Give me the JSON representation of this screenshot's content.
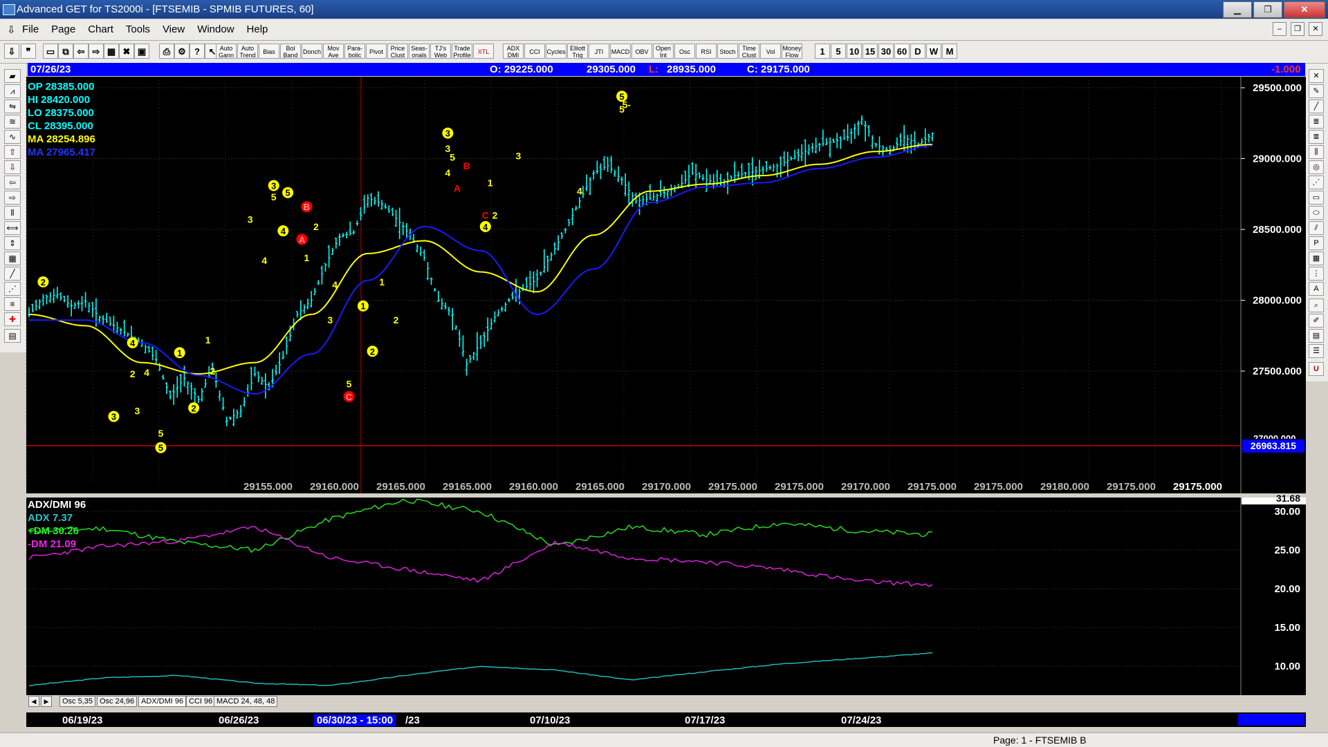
{
  "window": {
    "title": "Advanced GET for TS2000i - [FTSEMIB - SPMIB FUTURES, 60]"
  },
  "menu": {
    "items": [
      "File",
      "Page",
      "Chart",
      "Tools",
      "View",
      "Window",
      "Help"
    ]
  },
  "toolbar": {
    "buttons": [
      "Auto Gann",
      "Auto Trend",
      "Bias",
      "Bol Band",
      "Donch",
      "Mov Ave",
      "Para-bolic",
      "Pivot",
      "Price Clust",
      "Seas-onals",
      "TJ's Web",
      "Trade Profile",
      "XTL",
      "ADX DMI",
      "CCI",
      "Cycles",
      "Elliott Trig",
      "JTI",
      "MACD",
      "OBV",
      "Open Int",
      "Osc",
      "RSI",
      "Stoch",
      "Time Clust",
      "Vol",
      "Money Flow"
    ],
    "timeframes": [
      "1",
      "5",
      "10",
      "15",
      "30",
      "60",
      "D",
      "W",
      "M"
    ]
  },
  "info_bar": {
    "date": "07/26/23",
    "open": "O: 29225.000",
    "high": "29305.000",
    "low_label": "L:",
    "low": "28935.000",
    "close": "C: 29175.000",
    "change": "-1.000"
  },
  "readout": {
    "op": "OP 28385.000",
    "hi": "HI  28420.000",
    "lo": "LO  28375.000",
    "cl": "CL  28395.000",
    "ma1": "MA  28254.896",
    "ma2": "MA  27965.417"
  },
  "price_axis": {
    "ticks": [
      "29500.000",
      "29000.000",
      "28500.000",
      "28000.000",
      "27500.000"
    ],
    "current": "26963.815",
    "cut_label": "27000.000"
  },
  "x_price_labels": [
    "29155.000",
    "29160.000",
    "29165.000",
    "29165.000",
    "29160.000",
    "29165.000",
    "29170.000",
    "29175.000",
    "29175.000",
    "29170.000",
    "29175.000",
    "29175.000",
    "29180.000",
    "29175.000",
    "29175.000"
  ],
  "colors": {
    "bars": "#00ffff",
    "ma_fast": "#ffff00",
    "ma_slow": "#1a1aff",
    "wave_yellow": "#ffff00",
    "wave_red": "#ff0000",
    "info_bar": "#0000ff"
  },
  "chart_data": [
    {
      "type": "line",
      "series": [
        {
          "name": "Price (close)",
          "x": [
            0,
            3,
            6,
            9,
            12,
            15,
            18,
            21,
            24,
            27,
            30,
            33,
            36,
            39,
            42,
            45,
            48,
            51,
            54,
            57,
            60,
            63,
            66,
            69,
            72,
            75,
            78,
            81,
            84,
            87,
            90,
            93,
            96,
            99,
            102,
            105,
            108,
            111,
            114,
            117,
            120,
            123,
            126,
            129,
            132,
            135,
            138,
            141,
            144,
            147,
            150,
            153,
            156,
            159,
            162,
            165,
            168,
            171,
            174,
            177,
            180,
            183,
            186,
            189,
            192
          ],
          "values": [
            27900,
            28020,
            28040,
            27960,
            27990,
            27880,
            27820,
            27760,
            27700,
            27580,
            27320,
            27450,
            27300,
            27520,
            27150,
            27220,
            27480,
            27380,
            27600,
            27900,
            28000,
            28250,
            28450,
            28480,
            28720,
            28680,
            28580,
            28460,
            28300,
            28000,
            27900,
            27550,
            27700,
            27880,
            28000,
            28080,
            28150,
            28320,
            28500,
            28700,
            28900,
            28950,
            28850,
            28700,
            28720,
            28760,
            28800,
            28900,
            28850,
            28820,
            28880,
            28900,
            28920,
            28950,
            29000,
            29050,
            29100,
            29120,
            29150,
            29280,
            29100,
            29050,
            29150,
            29100,
            29175
          ]
        },
        {
          "name": "MA 28254.896",
          "x": [
            0,
            12,
            24,
            36,
            48,
            60,
            72,
            84,
            96,
            108,
            120,
            132,
            144,
            156,
            168,
            180,
            192
          ],
          "values": [
            27900,
            27820,
            27560,
            27480,
            27560,
            27900,
            28330,
            28420,
            28200,
            28060,
            28460,
            28770,
            28820,
            28880,
            28960,
            29050,
            29100
          ]
        },
        {
          "name": "MA 27965.417",
          "x": [
            0,
            12,
            24,
            36,
            48,
            60,
            72,
            84,
            96,
            108,
            120,
            132,
            144,
            156,
            168,
            180,
            192
          ],
          "values": [
            27860,
            27860,
            27700,
            27470,
            27340,
            27620,
            28140,
            28520,
            28350,
            27900,
            28220,
            28690,
            28800,
            28830,
            28930,
            29010,
            29090
          ]
        }
      ],
      "ylim": [
        27000,
        29550
      ],
      "yticks": [
        27500,
        28000,
        28500,
        29000,
        29500
      ],
      "waves": [
        {
          "label": "2",
          "x": 3,
          "y": 28130,
          "circled": true,
          "color": "yellow"
        },
        {
          "label": "4",
          "x": 22,
          "y": 27700,
          "circled": true,
          "color": "yellow"
        },
        {
          "label": "2",
          "x": 22,
          "y": 27480,
          "circled": false,
          "color": "yellow"
        },
        {
          "label": "4",
          "x": 25,
          "y": 27490,
          "circled": false,
          "color": "yellow"
        },
        {
          "label": "3",
          "x": 18,
          "y": 27180,
          "circled": true,
          "color": "yellow"
        },
        {
          "label": "3",
          "x": 23,
          "y": 27220,
          "circled": false,
          "color": "yellow"
        },
        {
          "label": "5",
          "x": 28,
          "y": 27060,
          "circled": false,
          "color": "yellow"
        },
        {
          "label": "5",
          "x": 28,
          "y": 26960,
          "circled": true,
          "color": "yellow"
        },
        {
          "label": "1",
          "x": 32,
          "y": 27630,
          "circled": true,
          "color": "yellow"
        },
        {
          "label": "2",
          "x": 35,
          "y": 27240,
          "circled": true,
          "color": "yellow"
        },
        {
          "label": "1",
          "x": 38,
          "y": 27720,
          "circled": false,
          "color": "yellow"
        },
        {
          "label": "2",
          "x": 39,
          "y": 27500,
          "circled": false,
          "color": "yellow"
        },
        {
          "label": "3",
          "x": 47,
          "y": 28570,
          "circled": false,
          "color": "yellow"
        },
        {
          "label": "4",
          "x": 50,
          "y": 28280,
          "circled": false,
          "color": "yellow"
        },
        {
          "label": "3",
          "x": 52,
          "y": 28810,
          "circled": true,
          "color": "yellow"
        },
        {
          "label": "5",
          "x": 52,
          "y": 28730,
          "circled": false,
          "color": "yellow"
        },
        {
          "label": "5",
          "x": 55,
          "y": 28760,
          "circled": true,
          "color": "yellow"
        },
        {
          "label": "4",
          "x": 54,
          "y": 28490,
          "circled": true,
          "color": "yellow"
        },
        {
          "label": "B",
          "x": 59,
          "y": 28660,
          "circled": true,
          "color": "red"
        },
        {
          "label": "A",
          "x": 58,
          "y": 28430,
          "circled": true,
          "color": "red"
        },
        {
          "label": "2",
          "x": 61,
          "y": 28520,
          "circled": false,
          "color": "yellow"
        },
        {
          "label": "1",
          "x": 59,
          "y": 28300,
          "circled": false,
          "color": "yellow"
        },
        {
          "label": "4",
          "x": 65,
          "y": 28110,
          "circled": false,
          "color": "yellow"
        },
        {
          "label": "3",
          "x": 64,
          "y": 27860,
          "circled": false,
          "color": "yellow"
        },
        {
          "label": "5",
          "x": 68,
          "y": 27410,
          "circled": false,
          "color": "yellow"
        },
        {
          "label": "C",
          "x": 68,
          "y": 27320,
          "circled": true,
          "color": "red"
        },
        {
          "label": "1",
          "x": 71,
          "y": 27960,
          "circled": true,
          "color": "yellow"
        },
        {
          "label": "2",
          "x": 73,
          "y": 27640,
          "circled": true,
          "color": "yellow"
        },
        {
          "label": "1",
          "x": 75,
          "y": 28130,
          "circled": false,
          "color": "yellow"
        },
        {
          "label": "2",
          "x": 78,
          "y": 27860,
          "circled": false,
          "color": "yellow"
        },
        {
          "label": "3",
          "x": 89,
          "y": 29180,
          "circled": true,
          "color": "yellow"
        },
        {
          "label": "3",
          "x": 89,
          "y": 29070,
          "circled": false,
          "color": "yellow"
        },
        {
          "label": "5",
          "x": 90,
          "y": 29010,
          "circled": false,
          "color": "yellow"
        },
        {
          "label": "4",
          "x": 89,
          "y": 28900,
          "circled": false,
          "color": "yellow"
        },
        {
          "label": "B",
          "x": 93,
          "y": 28950,
          "circled": false,
          "color": "red"
        },
        {
          "label": "A",
          "x": 91,
          "y": 28790,
          "circled": false,
          "color": "red"
        },
        {
          "label": "1",
          "x": 98,
          "y": 28830,
          "circled": false,
          "color": "yellow"
        },
        {
          "label": "C",
          "x": 97,
          "y": 28600,
          "circled": false,
          "color": "red"
        },
        {
          "label": "2",
          "x": 99,
          "y": 28600,
          "circled": false,
          "color": "yellow"
        },
        {
          "label": "4",
          "x": 97,
          "y": 28520,
          "circled": true,
          "color": "yellow"
        },
        {
          "label": "3",
          "x": 104,
          "y": 29020,
          "circled": false,
          "color": "yellow"
        },
        {
          "label": "4",
          "x": 117,
          "y": 28770,
          "circled": false,
          "color": "yellow"
        },
        {
          "label": "5",
          "x": 126,
          "y": 29440,
          "circled": true,
          "color": "yellow"
        },
        {
          "label": "5",
          "x": 126,
          "y": 29350,
          "circled": false,
          "color": "yellow"
        },
        {
          "label": "5-",
          "x": 127,
          "y": 29380,
          "circled": false,
          "color": "yellow"
        }
      ]
    },
    {
      "type": "line",
      "title": "ADX/DMI 96",
      "series": [
        {
          "name": "ADX 7.37",
          "x": [
            0,
            16,
            32,
            48,
            64,
            80,
            96,
            112,
            128,
            144,
            160,
            176,
            192
          ],
          "values": [
            7.5,
            8.5,
            8.8,
            7.8,
            7.5,
            8.8,
            10.0,
            9.5,
            8.2,
            9.3,
            10.3,
            11.0,
            11.7
          ]
        },
        {
          "name": "+DM 30.26",
          "x": [
            0,
            16,
            32,
            48,
            64,
            80,
            96,
            112,
            128,
            144,
            160,
            176,
            192
          ],
          "values": [
            27.5,
            27.8,
            26.0,
            25.0,
            29.0,
            31.5,
            30.0,
            25.5,
            28.0,
            27.0,
            28.5,
            27.5,
            27.0
          ]
        },
        {
          "name": "-DM  21.09",
          "x": [
            0,
            16,
            32,
            48,
            64,
            80,
            96,
            112,
            128,
            144,
            160,
            176,
            192
          ],
          "values": [
            24.0,
            25.5,
            26.2,
            28.0,
            24.0,
            22.5,
            21.0,
            26.0,
            24.0,
            23.5,
            22.5,
            21.0,
            20.5
          ]
        }
      ],
      "ylim": [
        7.0,
        31.68
      ],
      "yticks": [
        10.0,
        15.0,
        20.0,
        25.0,
        30.0
      ],
      "top_label": "31.68",
      "ticks_text": [
        "30.00",
        "25.00",
        "20.00",
        "15.00",
        "10.00"
      ]
    }
  ],
  "tabs": [
    "Osc 5,35",
    "Osc 24,96",
    "ADX/DMI 96",
    "CCI 96",
    "MACD 24, 48, 48"
  ],
  "dates": {
    "d1": "06/19/23",
    "d2": "06/26/23",
    "d3": "06/30/23 - 15:00",
    "d3b": "/23",
    "d4": "07/10/23",
    "d5": "07/17/23",
    "d6": "07/24/23"
  },
  "status": {
    "page": "Page: 1 - FTSEMIB B"
  }
}
